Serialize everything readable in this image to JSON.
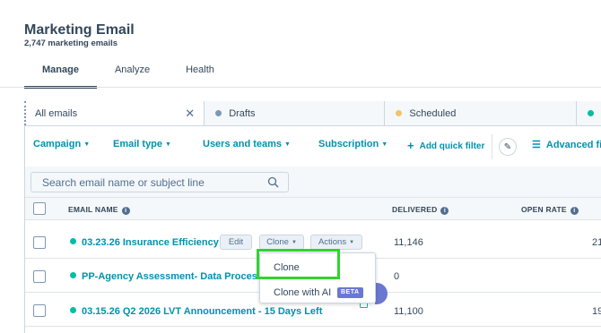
{
  "header": {
    "title": "Marketing Email",
    "subtitle": "2,747 marketing emails"
  },
  "tabs": [
    {
      "label": "Manage",
      "active": true
    },
    {
      "label": "Analyze",
      "active": false
    },
    {
      "label": "Health",
      "active": false
    }
  ],
  "view_tabs": {
    "all": "All emails",
    "drafts": "Drafts",
    "scheduled": "Scheduled",
    "drafts_color": "#7c98b6",
    "scheduled_color": "#f5c26b"
  },
  "filters": {
    "campaign": "Campaign",
    "email_type": "Email type",
    "users_teams": "Users and teams",
    "subscription": "Subscription",
    "add_quick_filter": "Add quick filter",
    "advanced": "Advanced fi"
  },
  "search": {
    "placeholder": "Search email name or subject line"
  },
  "table": {
    "headers": {
      "email_name": "EMAIL NAME",
      "delivered": "DELIVERED",
      "open_rate": "OPEN RATE"
    },
    "rows": [
      {
        "name": "03.23.26 Insurance Efficiency",
        "delivered": "11,146",
        "open_rate": "21"
      },
      {
        "name": "PP-Agency Assessment- Data Processi",
        "delivered": "0",
        "open_rate": ""
      },
      {
        "name": "03.15.26 Q2 2026 LVT Announcement - 15 Days Left",
        "delivered": "11,100",
        "open_rate": "19"
      }
    ],
    "row_actions": {
      "edit": "Edit",
      "clone": "Clone",
      "actions": "Actions"
    }
  },
  "clone_menu": {
    "clone": "Clone",
    "clone_ai": "Clone with AI",
    "beta": "BETA"
  },
  "colors": {
    "accent": "#0091ae",
    "status_published": "#00bda5",
    "highlight": "#2fd52c"
  }
}
